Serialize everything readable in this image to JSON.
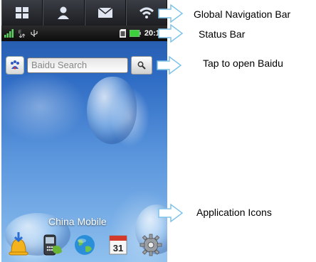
{
  "status_bar": {
    "time": "20:18"
  },
  "search": {
    "placeholder": "Baidu Search"
  },
  "carrier": "China Mobile",
  "dock": {
    "apps": [
      {
        "icon": "notification-bell-icon"
      },
      {
        "icon": "phone-dialer-icon"
      },
      {
        "icon": "globe-browser-icon"
      },
      {
        "icon": "calendar-icon",
        "label": "31"
      },
      {
        "icon": "settings-gear-icon"
      }
    ]
  },
  "annotations": {
    "global_nav": "Global Navigation Bar",
    "status_bar": "Status Bar",
    "baidu": "Tap to open Baidu",
    "apps": "Application Icons"
  },
  "colors": {
    "arrow_outline": "#7fc3e8",
    "battery": "#3cd13c",
    "signal": "#5fd35f"
  }
}
